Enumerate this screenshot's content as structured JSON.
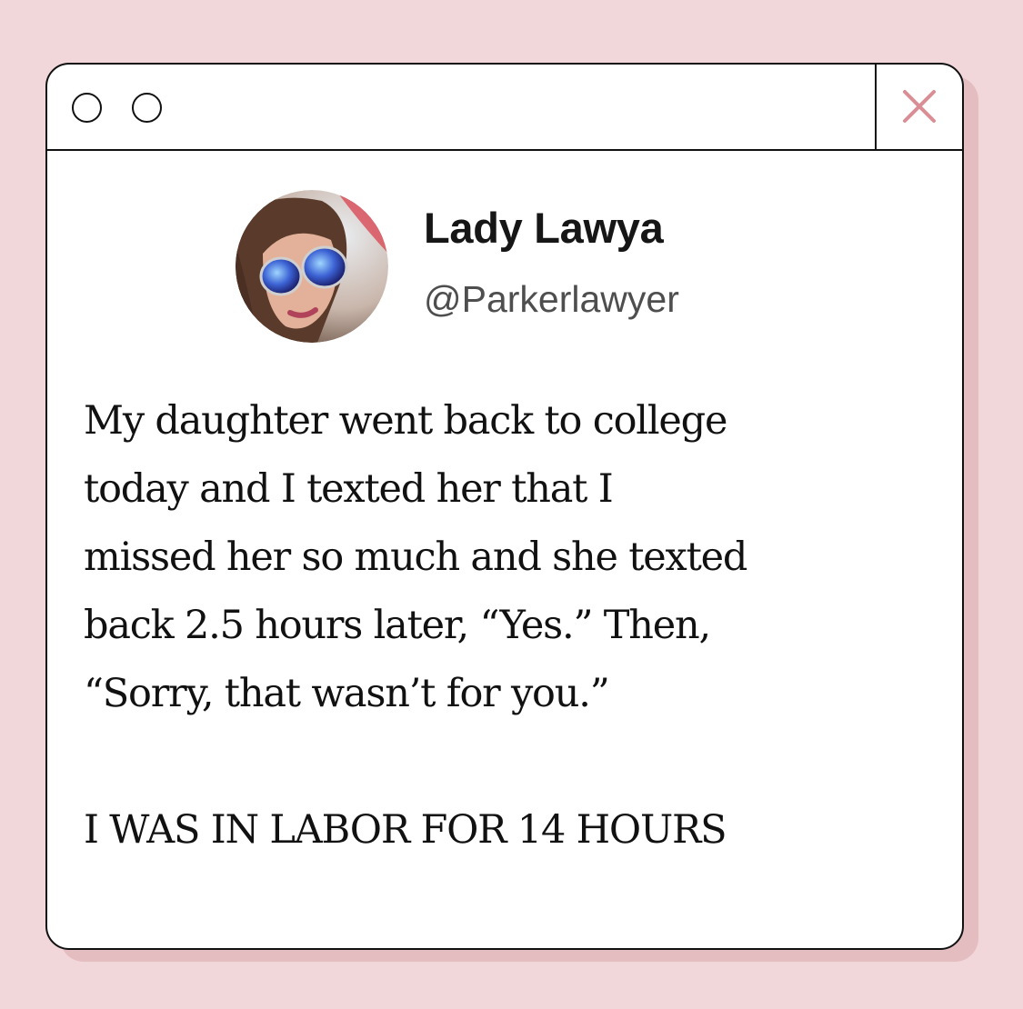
{
  "colors": {
    "background": "#f2d7da",
    "shadow": "#e4bdc1",
    "window": "#ffffff",
    "border": "#111111",
    "close_icon": "#d98e95"
  },
  "window": {
    "controls": [
      "circle-button-icon",
      "circle-button-icon"
    ],
    "close_icon": "close-icon"
  },
  "profile": {
    "name": "Lady Lawya",
    "handle": "@Parkerlawyer",
    "avatar_icon": "avatar"
  },
  "post": {
    "lines": [
      "My daughter went back to college",
      "today and I texted her that I",
      "missed her so much and she texted",
      "back 2.5 hours later, “Yes.” Then,",
      "“Sorry, that wasn’t for you.”"
    ],
    "shout": "I WAS IN LABOR FOR 14 HOURS"
  }
}
